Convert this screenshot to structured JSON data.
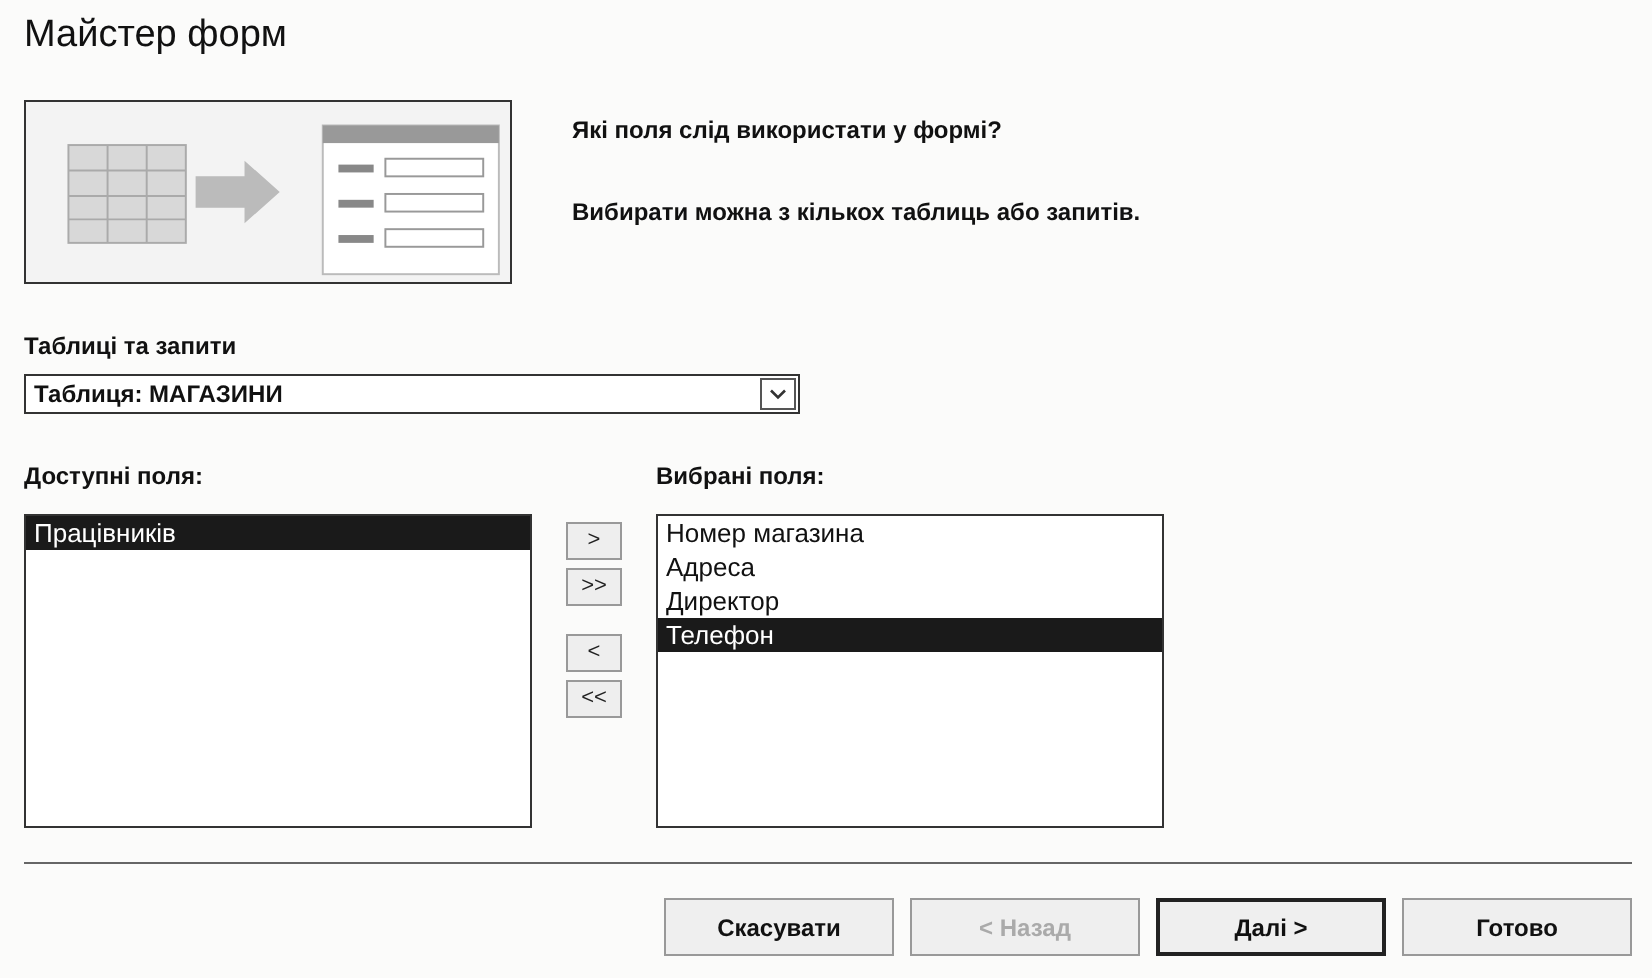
{
  "window": {
    "title": "Майстер форм"
  },
  "intro": {
    "question": "Які поля слід використати у формі?",
    "hint": "Вибирати можна з кількох таблиць або запитів."
  },
  "source": {
    "label": "Таблиці та запити",
    "value": "Таблиця: МАГАЗИНИ"
  },
  "available": {
    "label": "Доступні поля:",
    "items": [
      {
        "text": "Працівників",
        "selected": true
      }
    ]
  },
  "move_buttons": [
    {
      "label": ">",
      "disabled": false
    },
    {
      "label": ">>",
      "disabled": false
    },
    {
      "label": "<",
      "disabled": false
    },
    {
      "label": "<<",
      "disabled": false
    }
  ],
  "selected_fields": {
    "label": "Вибрані поля:",
    "items": [
      {
        "text": "Номер магазина",
        "selected": false
      },
      {
        "text": "Адреса",
        "selected": false
      },
      {
        "text": "Директор",
        "selected": false
      },
      {
        "text": "Телефон",
        "selected": true
      }
    ]
  },
  "buttons": [
    {
      "label": "Скасувати",
      "disabled": false,
      "default": false
    },
    {
      "label": "< Назад",
      "disabled": true,
      "default": false
    },
    {
      "label": "Далі >",
      "disabled": false,
      "default": true
    },
    {
      "label": "Готово",
      "disabled": false,
      "default": false
    }
  ]
}
